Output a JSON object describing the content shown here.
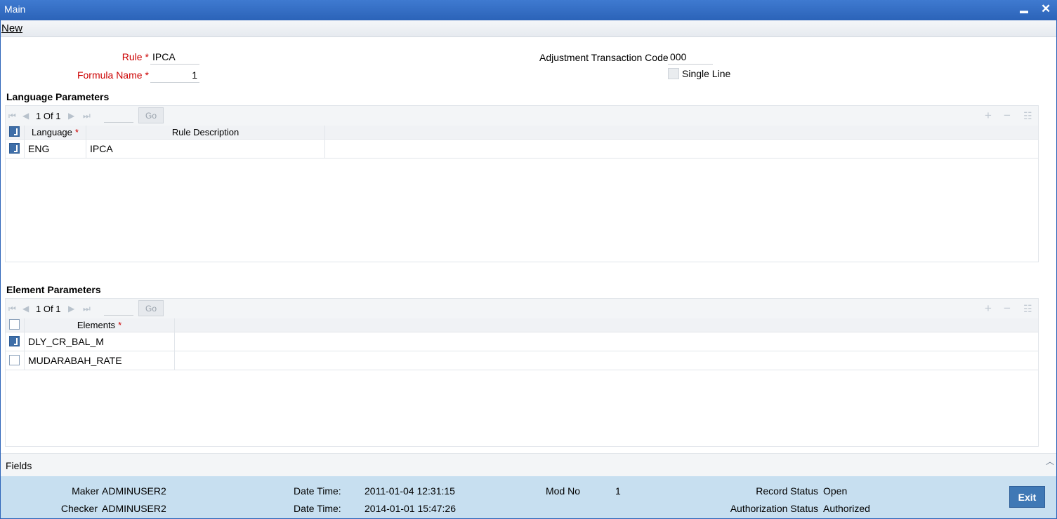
{
  "window": {
    "title": "Main",
    "minimize": "▬",
    "close": "✕"
  },
  "menu": {
    "new_label": "New"
  },
  "form": {
    "rule_label": "Rule",
    "rule_value": "IPCA",
    "formula_label": "Formula Name",
    "formula_value": "1",
    "adj_label": "Adjustment Transaction Code",
    "adj_value": "000",
    "single_line_label": "Single Line",
    "required_mark": "*"
  },
  "language_section": {
    "title": "Language Parameters",
    "pager": {
      "current": "1",
      "of": "Of",
      "total": "1",
      "go": "Go"
    },
    "headers": {
      "language": "Language",
      "description": "Rule Description"
    },
    "rows": [
      {
        "language": "ENG",
        "description": "IPCA",
        "checked": true
      }
    ]
  },
  "element_section": {
    "title": "Element Parameters",
    "pager": {
      "current": "1",
      "of": "Of",
      "total": "1",
      "go": "Go"
    },
    "headers": {
      "elements": "Elements"
    },
    "rows": [
      {
        "element": "DLY_CR_BAL_M",
        "checked": true
      },
      {
        "element": "MUDARABAH_RATE",
        "checked": false
      }
    ]
  },
  "fields_bar": {
    "label": "Fields"
  },
  "footer": {
    "maker_label": "Maker",
    "maker_value": "ADMINUSER2",
    "checker_label": "Checker",
    "checker_value": "ADMINUSER2",
    "dt_label": "Date Time:",
    "maker_dt": "2011-01-04 12:31:15",
    "checker_dt": "2014-01-01 15:47:26",
    "mod_label": "Mod No",
    "mod_value": "1",
    "record_label": "Record Status",
    "record_value": "Open",
    "auth_label": "Authorization Status",
    "auth_value": "Authorized",
    "exit_label": "Exit"
  }
}
